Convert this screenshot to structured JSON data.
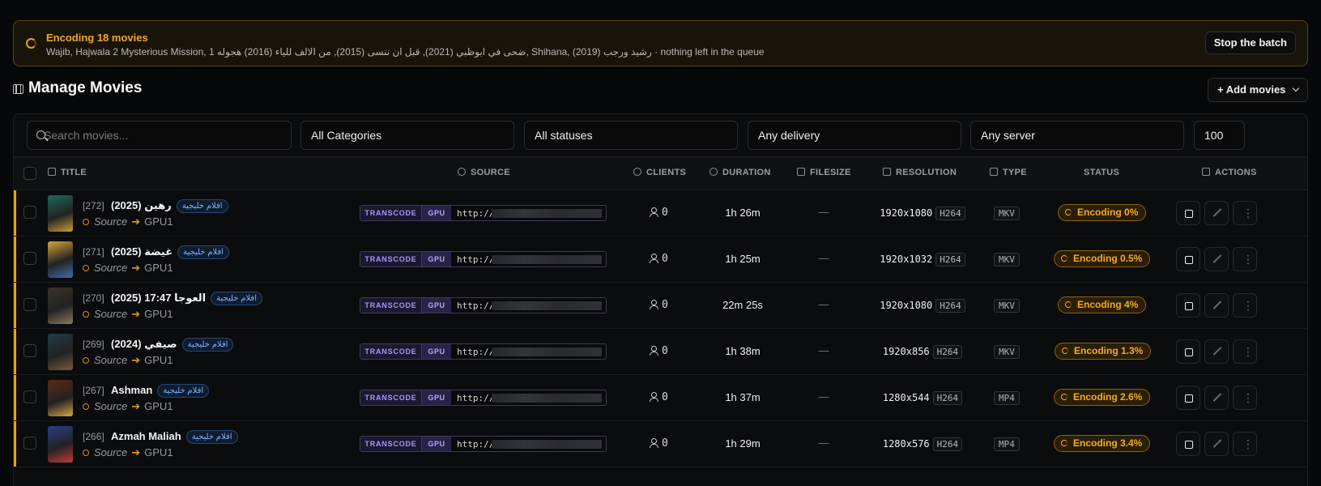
{
  "banner": {
    "title": "Encoding 18 movies",
    "subtitle": "Wajib, Hajwala 2 Mysterious Mission, ضحى في ابوظبي (2021), قبل ان ننسى (2015), من الالف للياء (2016) هجوله 1, Shihana, (2019) رشيد ورجب · nothing left in the queue",
    "stop_label": "Stop the batch"
  },
  "page": {
    "title": "Manage Movies",
    "add_label": "+ Add movies"
  },
  "filters": {
    "search_placeholder": "Search movies...",
    "category": "All Categories",
    "status": "All statuses",
    "delivery": "Any delivery",
    "server": "Any server",
    "per_page": "100"
  },
  "columns": {
    "title": "TITLE",
    "source": "SOURCE",
    "clients": "CLIENTS",
    "duration": "DURATION",
    "filesize": "FILESIZE",
    "resolution": "RESOLUTION",
    "type": "TYPE",
    "status": "STATUS",
    "actions": "ACTIONS"
  },
  "rows": [
    {
      "id": "[272]",
      "title": "(2025) رهين",
      "category": "افلام خليجية",
      "source_label": "Source",
      "server": "GPU1",
      "mode": "TRANSCODE",
      "accel": "GPU",
      "url": "http://",
      "clients": "0",
      "duration": "1h 26m",
      "filesize": "—",
      "resolution": "1920x1080",
      "codec": "H264",
      "type": "MKV",
      "status": "Encoding 0%",
      "progress": 0,
      "poster_colors": [
        "#1e6a5a",
        "#c9a03a"
      ]
    },
    {
      "id": "[271]",
      "title": "(2025) غيضة",
      "category": "افلام خليجية",
      "source_label": "Source",
      "server": "GPU1",
      "mode": "TRANSCODE",
      "accel": "GPU",
      "url": "http://",
      "clients": "0",
      "duration": "1h 25m",
      "filesize": "—",
      "resolution": "1920x1032",
      "codec": "H264",
      "type": "MKV",
      "status": "Encoding 0.5%",
      "progress": 0.5,
      "poster_colors": [
        "#d8a43a",
        "#3f6fa8"
      ]
    },
    {
      "id": "[270]",
      "title": "(2025) 17:47 العوجا",
      "category": "افلام خليجية",
      "source_label": "Source",
      "server": "GPU1",
      "mode": "TRANSCODE",
      "accel": "GPU",
      "url": "http://",
      "clients": "0",
      "duration": "22m 25s",
      "filesize": "—",
      "resolution": "1920x1080",
      "codec": "H264",
      "type": "MKV",
      "status": "Encoding 4%",
      "progress": 4,
      "poster_colors": [
        "#3a3226",
        "#8a7a60"
      ]
    },
    {
      "id": "[269]",
      "title": "(2024) صيفي",
      "category": "افلام خليجية",
      "source_label": "Source",
      "server": "GPU1",
      "mode": "TRANSCODE",
      "accel": "GPU",
      "url": "http://",
      "clients": "0",
      "duration": "1h 38m",
      "filesize": "—",
      "resolution": "1920x856",
      "codec": "H264",
      "type": "MKV",
      "status": "Encoding 1.3%",
      "progress": 1.3,
      "poster_colors": [
        "#1f3c46",
        "#7a5a3a"
      ]
    },
    {
      "id": "[267]",
      "title": "Ashman",
      "category": "افلام خليجية",
      "source_label": "Source",
      "server": "GPU1",
      "mode": "TRANSCODE",
      "accel": "GPU",
      "url": "http://",
      "clients": "0",
      "duration": "1h 37m",
      "filesize": "—",
      "resolution": "1280x544",
      "codec": "H264",
      "type": "MP4",
      "status": "Encoding 2.6%",
      "progress": 2.6,
      "poster_colors": [
        "#5a2a14",
        "#d7a24a"
      ]
    },
    {
      "id": "[266]",
      "title": "Azmah Maliah",
      "category": "افلام خليجية",
      "source_label": "Source",
      "server": "GPU1",
      "mode": "TRANSCODE",
      "accel": "GPU",
      "url": "http://",
      "clients": "0",
      "duration": "1h 29m",
      "filesize": "—",
      "resolution": "1280x576",
      "codec": "H264",
      "type": "MP4",
      "status": "Encoding 3.4%",
      "progress": 3.4,
      "poster_colors": [
        "#2b3f86",
        "#c43a3a"
      ]
    }
  ],
  "colors": {
    "accent": "#e6a317",
    "status_text": "#f3ac2a",
    "category_text": "#7fb2ff",
    "transcode_text": "#a996ff"
  }
}
